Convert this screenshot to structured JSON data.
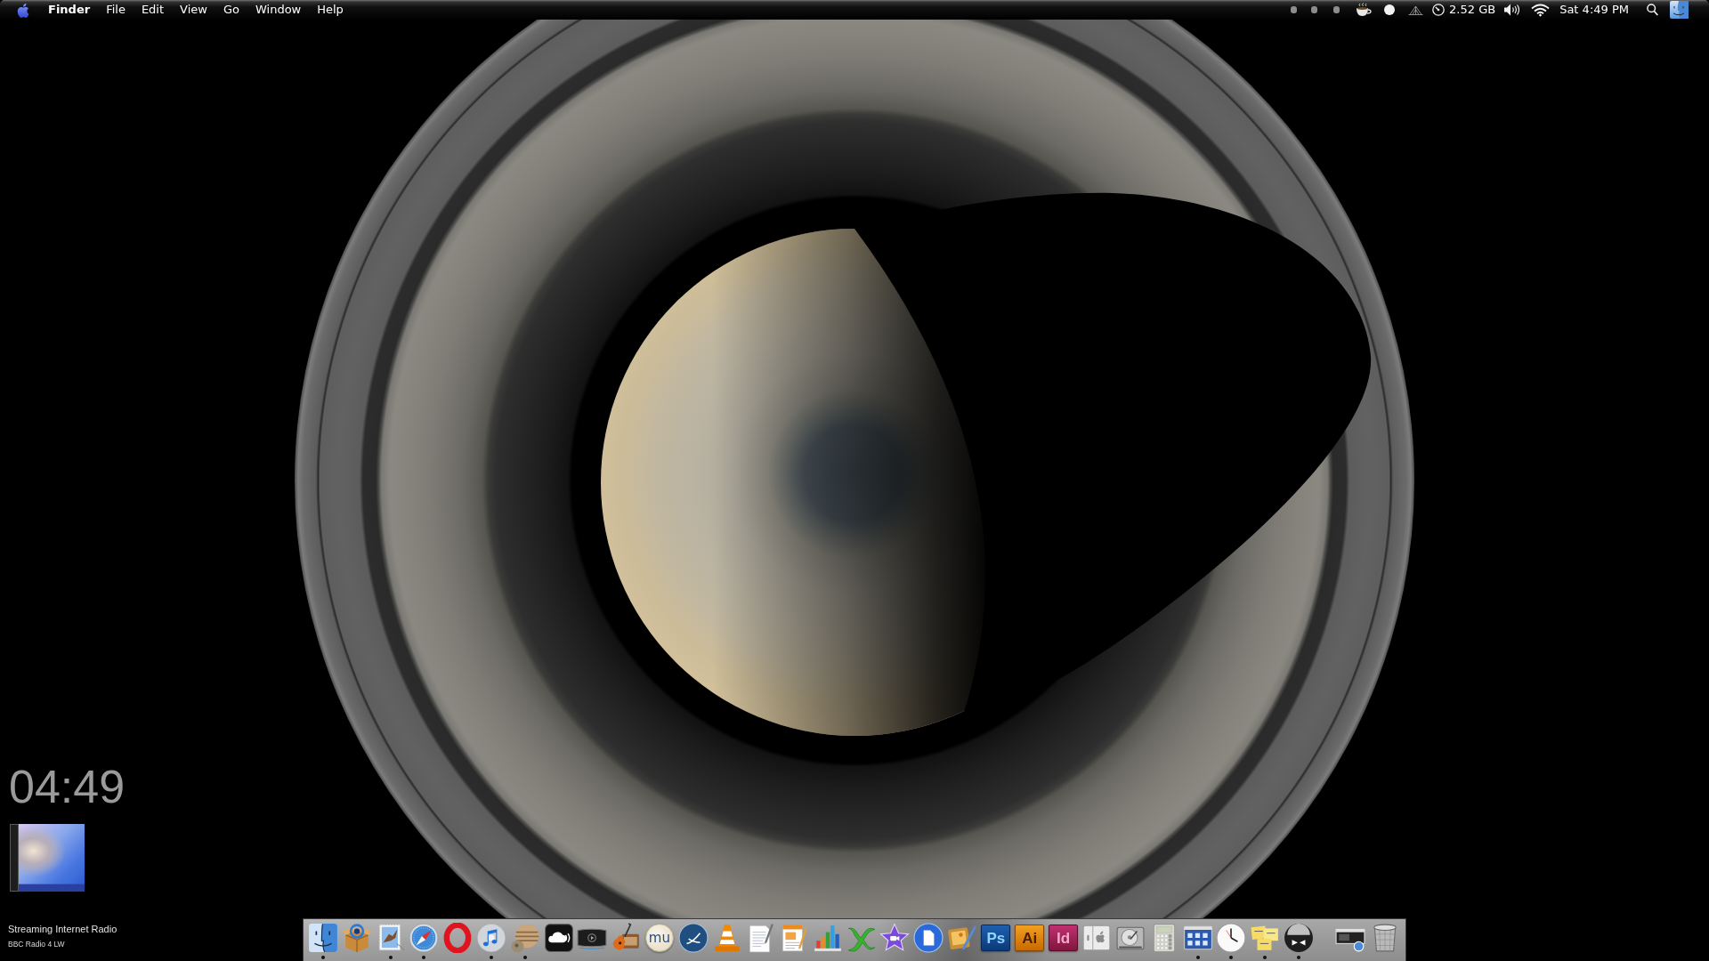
{
  "menu_bar": {
    "app_name": "Finder",
    "menus": [
      "File",
      "Edit",
      "View",
      "Go",
      "Window",
      "Help"
    ],
    "memory": "2.52 GB",
    "clock": "Sat 4:49 PM"
  },
  "desktop_clock": "04:49",
  "radio_widget": {
    "title": "Streaming Internet Radio",
    "station": "BBC Radio 4 LW"
  },
  "dock": {
    "applications": [
      {
        "running": true
      },
      {
        "running": false
      },
      {
        "running": true
      },
      {
        "running": true
      },
      {
        "running": false
      },
      {
        "running": true
      },
      {
        "running": true
      },
      {
        "running": false
      },
      {
        "running": false
      },
      {
        "running": false
      },
      {
        "running": false,
        "letters": "mu"
      },
      {
        "running": false
      },
      {
        "running": false
      },
      {
        "running": false
      },
      {
        "running": false
      },
      {
        "running": false
      },
      {
        "running": false
      },
      {
        "running": false
      },
      {
        "running": false
      },
      {
        "running": false
      },
      {
        "running": false,
        "letters": "Ps"
      },
      {
        "running": false,
        "letters": "Ai"
      },
      {
        "running": false,
        "letters": "Id"
      },
      {
        "running": false
      },
      {
        "running": false
      },
      {
        "running": false
      },
      {
        "running": true
      },
      {
        "running": true
      },
      {
        "running": true
      },
      {
        "running": true
      }
    ]
  }
}
